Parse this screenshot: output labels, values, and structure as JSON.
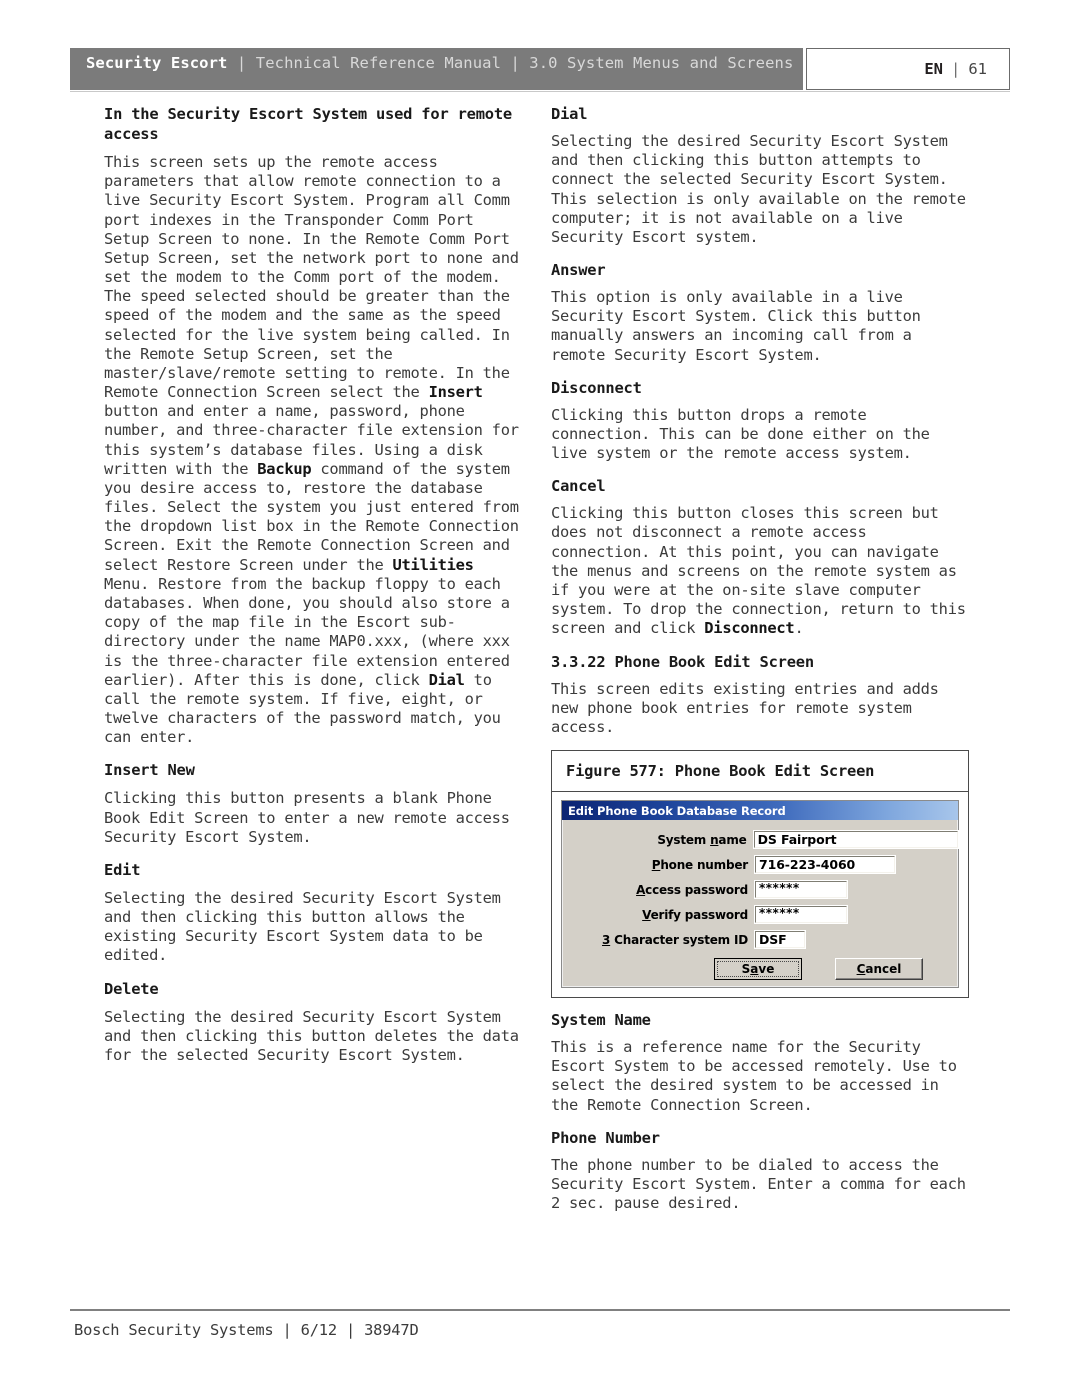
{
  "header": {
    "brand": "Security Escort",
    "rest": " | Technical Reference Manual | 3.0  System Menus and Screens",
    "lang": "EN",
    "separator": "|",
    "page_number": "61"
  },
  "left_column": {
    "heading_1": "In the Security Escort System used for remote access",
    "para_1_a": "This screen sets up the remote access parameters that allow remote connection to a live Security Escort System. Program all Comm port indexes in the Transponder Comm Port Setup Screen to none. In the Remote Comm Port Setup Screen, set the network port to none and set the modem to the Comm port of the modem. The speed selected should be greater than the speed of the modem and the same as the speed selected for the live system being called. In the Remote Setup Screen, set the master/slave/remote setting to remote. In the Remote Connection Screen select the ",
    "para_1_b1": "Insert",
    "para_1_c": " button and enter a name, password, phone number, and three-character file extension for this system’s database files. Using a disk written with the ",
    "para_1_b2": "Backup",
    "para_1_d": " command of the system you desire access to, restore the database files. Select the system you just entered from the dropdown list box in the Remote Connection Screen. Exit the Remote Connection Screen and select Restore Screen under the ",
    "para_1_b3": "Utilities",
    "para_1_e": " Menu. Restore from the backup floppy to each databases. When done, you should also store a copy of the map file in the Escort sub-directory under the name MAP0.xxx, (where xxx is the three-character file extension entered earlier). After this is done, click ",
    "para_1_b4": "Dial",
    "para_1_f": " to call the remote system. If five, eight, or twelve characters of the password match, you can enter.",
    "heading_2": "Insert New",
    "para_2": "Clicking this button presents a blank Phone Book Edit Screen to enter a new remote access Security Escort System.",
    "heading_3": "Edit",
    "para_3": "Selecting the desired Security Escort System and then clicking this button allows the existing Security Escort System data to be edited.",
    "heading_4": "Delete",
    "para_4": "Selecting the desired Security Escort System and then clicking this button deletes the data for the selected Security Escort System."
  },
  "right_column": {
    "heading_1": "Dial",
    "para_1": "Selecting the desired Security Escort System and then clicking this button attempts to connect the selected Security Escort System. This selection is only available on the remote computer; it is not available on a live Security Escort system.",
    "heading_2": "Answer",
    "para_2": "This option is only available in a live Security Escort System. Click this button manually answers an incoming call from a remote Security Escort System.",
    "heading_3": "Disconnect",
    "para_3": "Clicking this button drops a remote connection. This can be done either on the live system or the remote access system.",
    "heading_4": "Cancel",
    "para_4_a": "Clicking this button closes this screen but does not disconnect a remote access connection. At this point, you can navigate the menus and screens on the remote system as if you were at the on-site slave computer system. To drop the connection, return to this screen and click ",
    "para_4_b": "Disconnect",
    "para_4_c": ".",
    "heading_5": "3.3.22 Phone Book Edit Screen",
    "para_5": "This screen edits existing entries and adds new phone book entries for remote system access.",
    "figure_caption": "Figure 577: Phone Book Edit Screen",
    "heading_6": "System Name",
    "para_6": "This is a reference name for the Security Escort System to be accessed remotely. Use to select the desired system to be accessed in the Remote Connection Screen.",
    "heading_7": "Phone Number",
    "para_7": "The phone number to be dialed to access the Security Escort System. Enter a comma for each 2 sec. pause desired."
  },
  "dialog": {
    "title": "Edit Phone Book Database Record",
    "fields": [
      {
        "label_pre": "System ",
        "label_accel": "n",
        "label_post": "ame",
        "value": "DS Fairport",
        "width_class": "w-sysname",
        "is_password": false
      },
      {
        "label_pre": "",
        "label_accel": "P",
        "label_post": "hone number",
        "value": "716-223-4060",
        "width_class": "w-phone",
        "is_password": false
      },
      {
        "label_pre": "",
        "label_accel": "A",
        "label_post": "ccess password",
        "value": "******",
        "width_class": "w-pass",
        "is_password": true
      },
      {
        "label_pre": "",
        "label_accel": "V",
        "label_post": "erify password",
        "value": "******",
        "width_class": "w-pass",
        "is_password": true
      },
      {
        "label_pre": "",
        "label_accel": "3",
        "label_post": " Character system ID",
        "value": "DSF",
        "width_class": "w-sysid",
        "is_password": false
      }
    ],
    "save_pre": "S",
    "save_accel": "a",
    "save_post": "ve",
    "cancel_pre": "",
    "cancel_accel": "C",
    "cancel_post": "ancel"
  },
  "footer": {
    "text": "Bosch Security Systems | 6/12 | 38947D"
  }
}
